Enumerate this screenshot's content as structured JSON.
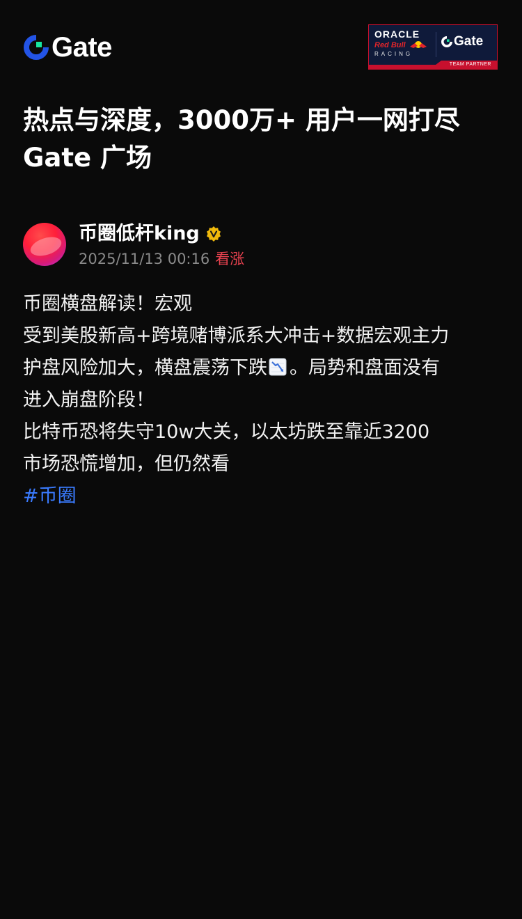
{
  "header": {
    "brand_name": "Gate",
    "partner_badge": {
      "oracle": "ORACLE",
      "red_bull": "Red Bull",
      "racing": "RACING",
      "gate": "Gate",
      "strip_label": "TEAM PARTNER"
    }
  },
  "headline": {
    "line1": "热点与深度，3000万+ 用户一网打尽",
    "line2": "Gate 广场"
  },
  "post": {
    "author": "币圈低杆king",
    "verified_icon": "verified-badge-icon",
    "time": "2025/11/13 00:16",
    "sentiment": "看涨",
    "lines": [
      "币圈横盘解读！宏观",
      "受到美股新高+跨境赌博派系大冲击+数据宏观主力",
      "护盘风险加大，横盘震荡下跌",
      "。局势和盘面没有",
      "进入崩盘阶段！",
      "比特币恐将失守10w大关，以太坊跌至靠近3200",
      "市场恐慌增加，但仍然看"
    ],
    "hashtag": "#币圈"
  },
  "colors": {
    "background": "#0a0a0a",
    "brand_blue": "#2354e6",
    "brand_green": "#17e6a1",
    "sentiment_red": "#e8424f",
    "hashtag_blue": "#3a7bff",
    "verified_yellow": "#f0b90b"
  }
}
